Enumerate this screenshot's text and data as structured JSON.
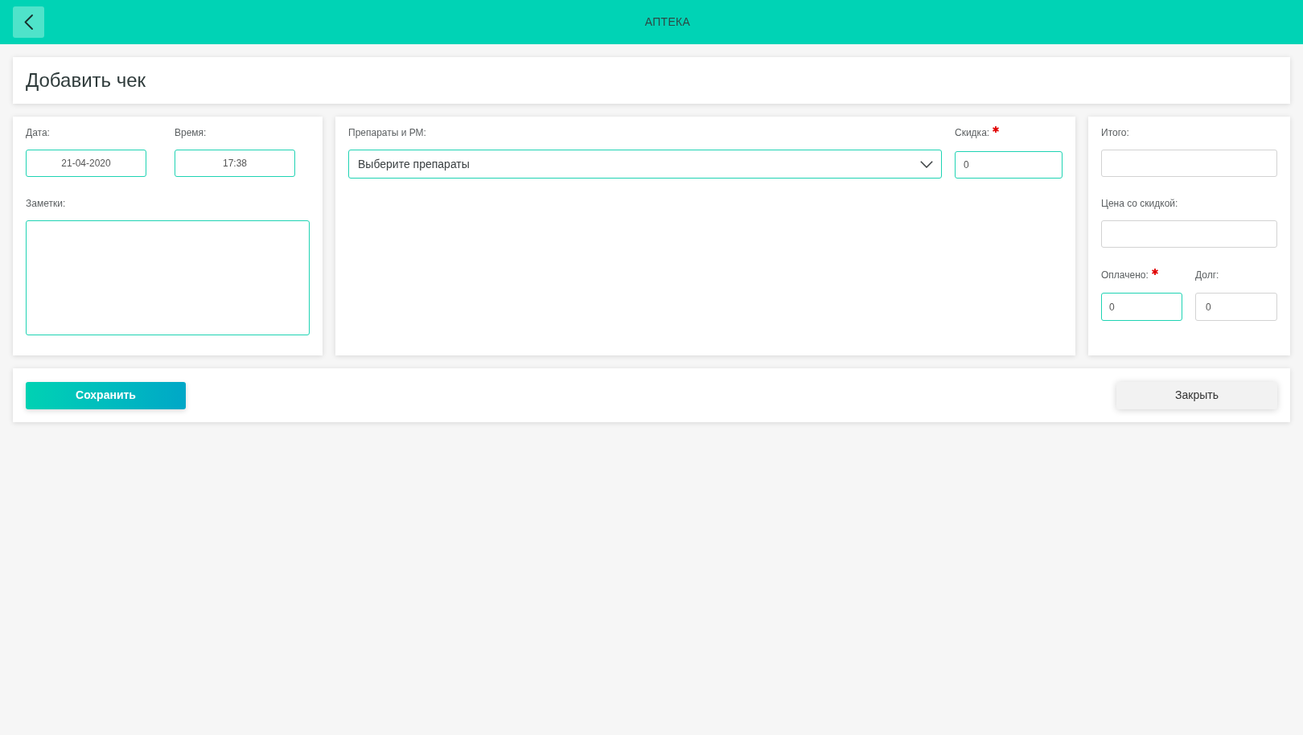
{
  "header": {
    "title": "АПТЕКА"
  },
  "page_title": "Добавить чек",
  "receipt_panel": {
    "date": {
      "label": "Дата:",
      "value": "21-04-2020",
      "required": false,
      "editable": true
    },
    "time": {
      "label": "Время:",
      "value": "17:38",
      "required": false,
      "editable": true
    },
    "notes": {
      "label": "Заметки:",
      "required": false,
      "editable": true
    }
  },
  "medicines_panel": {
    "medicines": {
      "label": "Препараты и РМ:",
      "placeholder": "Выберите препараты",
      "required": false,
      "editable": true
    },
    "discount": {
      "label": "Скидка:",
      "value": "0",
      "required": true,
      "editable": true
    }
  },
  "totals_panel": {
    "total": {
      "label": "Итого:",
      "required": false,
      "editable": false
    },
    "discounted_price": {
      "label": "Цена со скидкой:",
      "required": false,
      "editable": false
    },
    "paid": {
      "label": "Оплачено:",
      "value": "0",
      "required": true,
      "editable": true
    },
    "debt": {
      "label": "Долг:",
      "value": "0",
      "required": false,
      "editable": false
    }
  },
  "actions": [
    {
      "kind": "primary",
      "label": "Сохранить"
    },
    {
      "kind": "secondary",
      "label": "Закрыть"
    }
  ]
}
